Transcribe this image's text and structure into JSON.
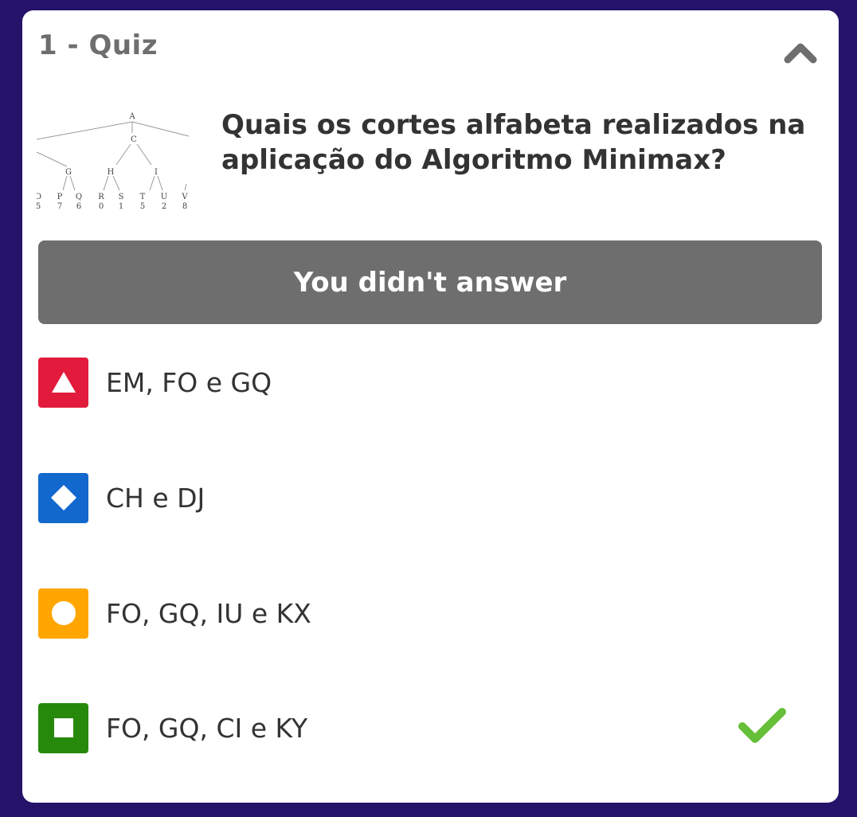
{
  "quiz": {
    "title": "1 - Quiz",
    "question": "Quais os cortes alfabeta realizados na aplicação do Algoritmo Minimax?",
    "thumbnail": {
      "icon": "minimax-tree-image",
      "root_label": "A",
      "child_label": "C",
      "node_labels": [
        "G",
        "H",
        "I"
      ],
      "leaf_labels": [
        "O",
        "P",
        "Q",
        "R",
        "S",
        "T",
        "U",
        "V"
      ],
      "leaf_values": [
        "5",
        "7",
        "6",
        "0",
        "1",
        "5",
        "2",
        "8"
      ]
    },
    "answer_status": "You didn't answer",
    "options": [
      {
        "label": "EM, FO e GQ",
        "shape": "triangle-icon",
        "color": "#e21b3c",
        "correct": false
      },
      {
        "label": "CH e DJ",
        "shape": "diamond-icon",
        "color": "#1368ce",
        "correct": false
      },
      {
        "label": "FO, GQ, IU e KX",
        "shape": "circle-icon",
        "color": "#ffa602",
        "correct": false
      },
      {
        "label": "FO, GQ, CI e KY",
        "shape": "square-icon",
        "color": "#26890c",
        "correct": true
      }
    ]
  },
  "colors": {
    "background": "#25136a",
    "banner": "#6e6e6e",
    "check": "#66bf39"
  },
  "icons": {
    "collapse": "chevron-up-icon",
    "correct": "checkmark-icon"
  }
}
